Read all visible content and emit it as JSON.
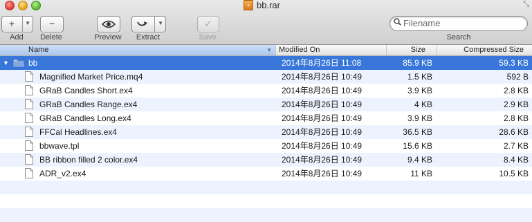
{
  "window": {
    "title": "bb.rar",
    "buttons": [
      "close",
      "minimize",
      "zoom"
    ]
  },
  "toolbar": {
    "add_label": "Add",
    "delete_label": "Delete",
    "preview_label": "Preview",
    "extract_label": "Extract",
    "save_label": "Save",
    "search_label": "Search",
    "search_placeholder": "Filename",
    "search_value": ""
  },
  "columns": {
    "name": "Name",
    "modified": "Modified On",
    "size": "Size",
    "compressed": "Compressed Size"
  },
  "folder": {
    "name": "bb",
    "modified": "2014年8月26日 11:08",
    "size": "85.9 KB",
    "compressed": "59.3 KB",
    "expanded": true,
    "selected": true
  },
  "files": [
    {
      "name": "Magnified Market Price.mq4",
      "modified": "2014年8月26日 10:49",
      "size": "1.5 KB",
      "compressed": "592 B"
    },
    {
      "name": "GRaB Candles Short.ex4",
      "modified": "2014年8月26日 10:49",
      "size": "3.9 KB",
      "compressed": "2.8 KB"
    },
    {
      "name": "GRaB Candles Range.ex4",
      "modified": "2014年8月26日 10:49",
      "size": "4 KB",
      "compressed": "2.9 KB"
    },
    {
      "name": "GRaB Candles Long.ex4",
      "modified": "2014年8月26日 10:49",
      "size": "3.9 KB",
      "compressed": "2.8 KB"
    },
    {
      "name": "FFCal Headlines.ex4",
      "modified": "2014年8月26日 10:49",
      "size": "36.5 KB",
      "compressed": "28.6 KB"
    },
    {
      "name": "bbwave.tpl",
      "modified": "2014年8月26日 10:49",
      "size": "15.6 KB",
      "compressed": "2.7 KB"
    },
    {
      "name": "BB ribbon filled 2 color.ex4",
      "modified": "2014年8月26日 10:49",
      "size": "9.4 KB",
      "compressed": "8.4 KB"
    },
    {
      "name": "ADR_v2.ex4",
      "modified": "2014年8月26日 10:49",
      "size": "11 KB",
      "compressed": "10.5 KB"
    }
  ],
  "colors": {
    "selection": "#3877d9",
    "alt_row": "#edf3fe",
    "folder": "#7fa9e0"
  }
}
